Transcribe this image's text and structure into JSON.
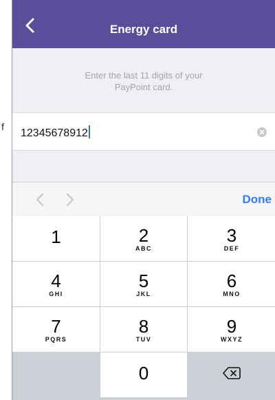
{
  "stray_text": "f",
  "navbar": {
    "title": "Energy card",
    "back_icon": "chevron-left-icon",
    "color": "#5b4c9c"
  },
  "instructions": {
    "line1": "Enter the last 11 digits of your",
    "line2": "PayPoint card."
  },
  "card_input": {
    "value": "12345678912",
    "clear_icon": "clear-circle-icon"
  },
  "keyboard_toolbar": {
    "prev_icon": "chevron-left-icon",
    "next_icon": "chevron-right-icon",
    "done_label": "Done",
    "done_color": "#2f7cf6"
  },
  "keypad": {
    "keys": [
      {
        "digit": "1",
        "letters": ""
      },
      {
        "digit": "2",
        "letters": "ABC"
      },
      {
        "digit": "3",
        "letters": "DEF"
      },
      {
        "digit": "4",
        "letters": "GHI"
      },
      {
        "digit": "5",
        "letters": "JKL"
      },
      {
        "digit": "6",
        "letters": "MNO"
      },
      {
        "digit": "7",
        "letters": "PQRS"
      },
      {
        "digit": "8",
        "letters": "TUV"
      },
      {
        "digit": "9",
        "letters": "WXYZ"
      },
      {
        "digit": "0",
        "letters": ""
      }
    ],
    "delete_icon": "backspace-icon"
  }
}
